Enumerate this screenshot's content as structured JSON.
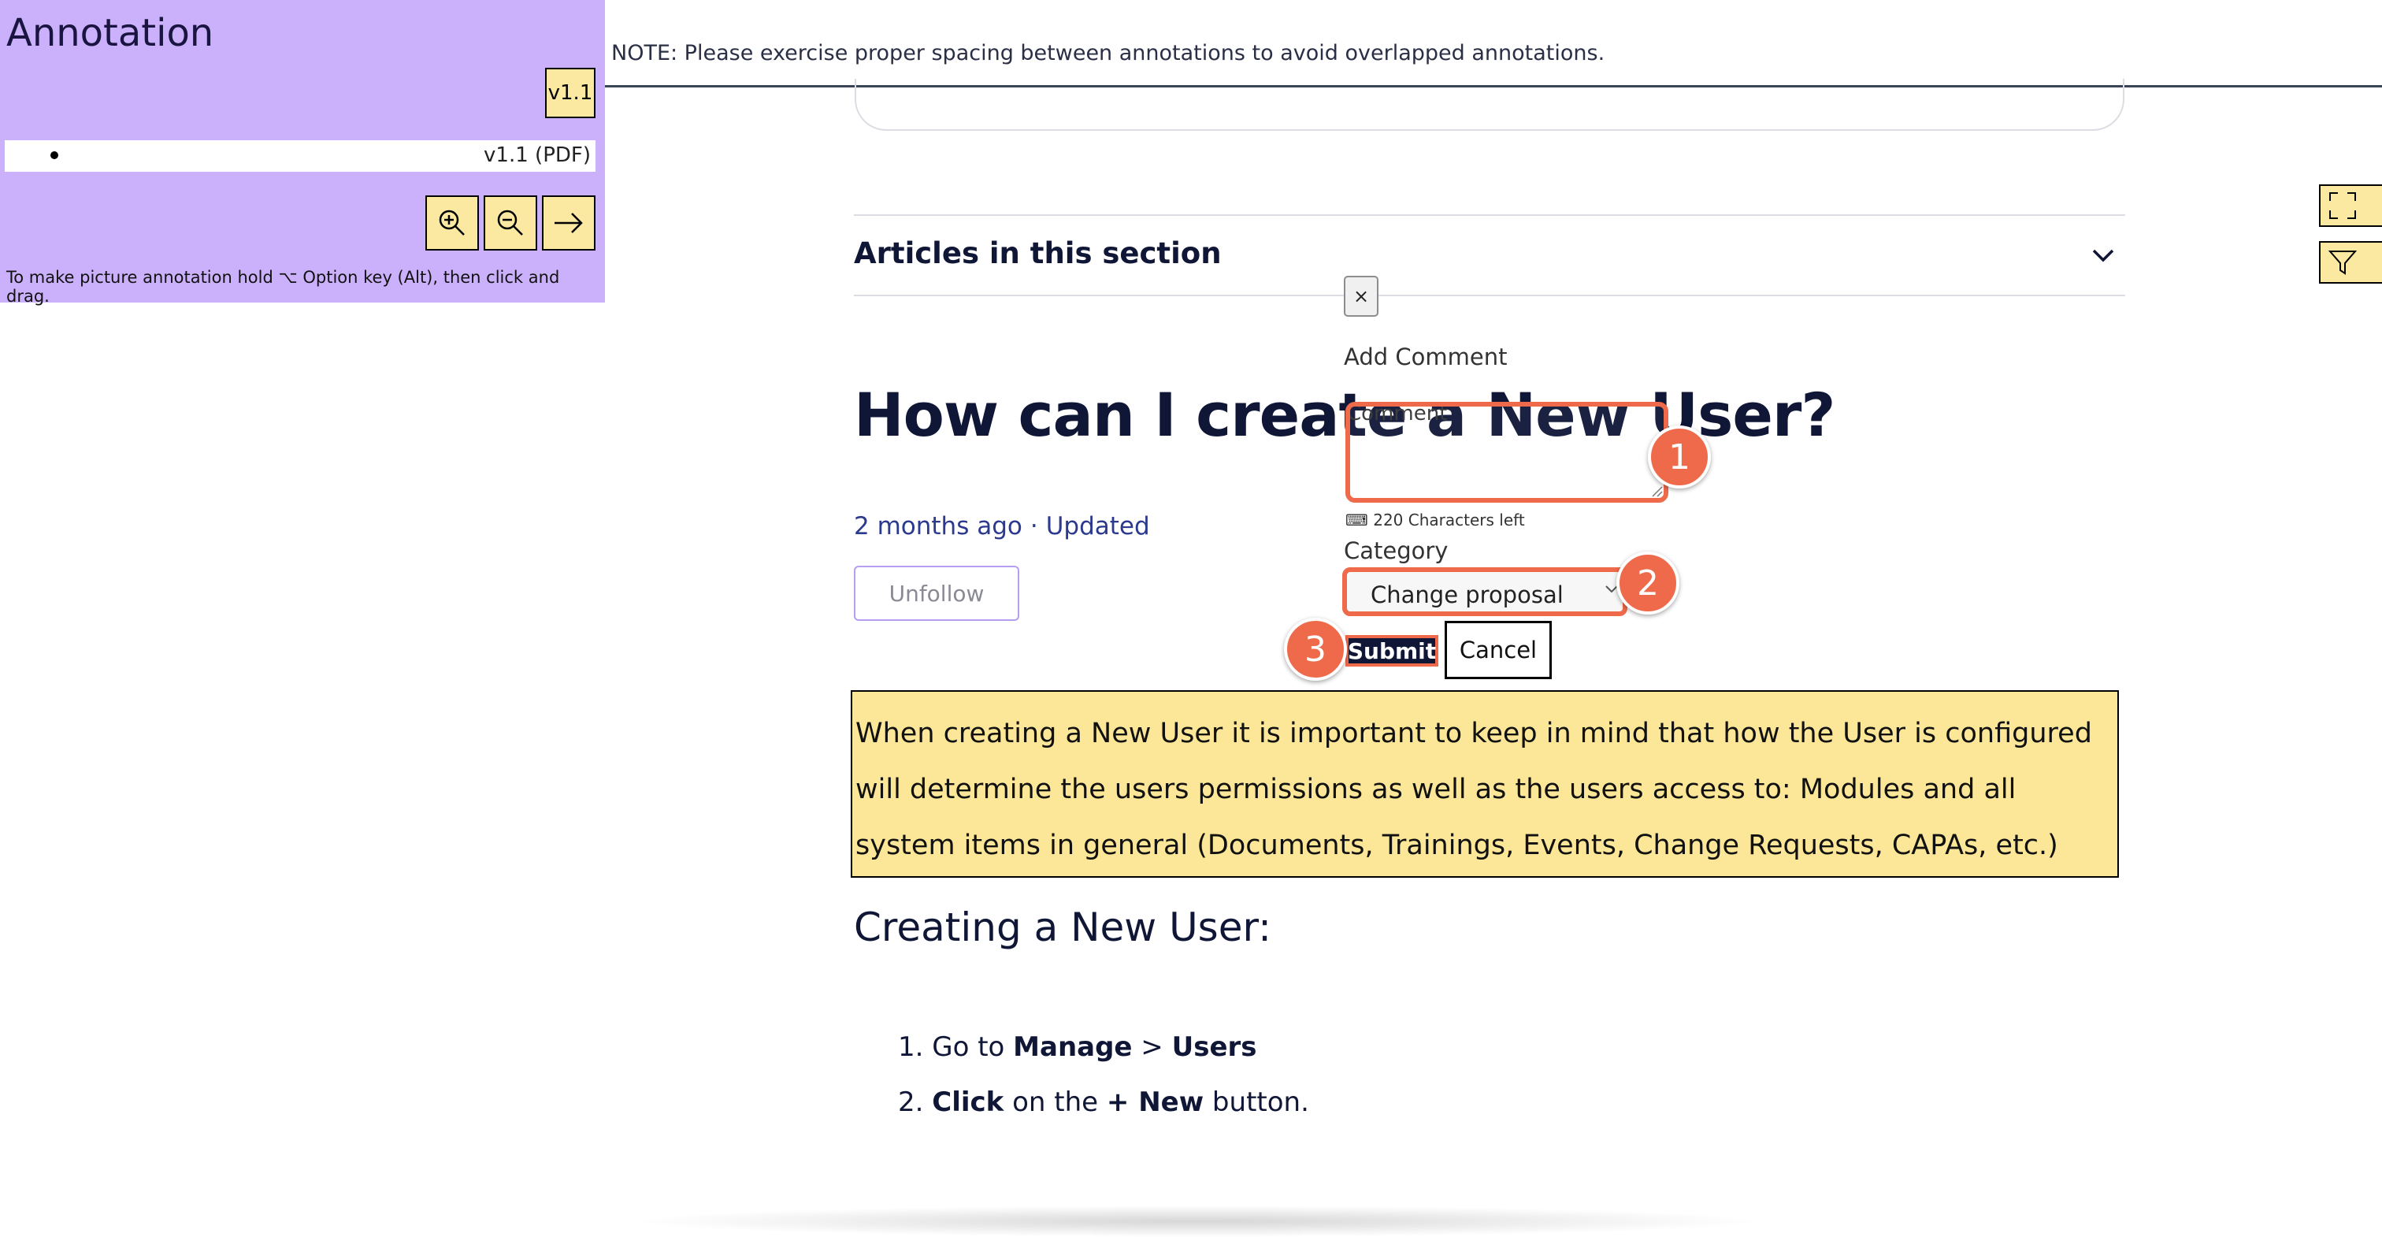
{
  "panel": {
    "title": "Annotation",
    "version_button": "v1.1",
    "version_items": [
      "v1.1 (PDF)"
    ],
    "hint": "To make picture annotation hold ⌥ Option key (Alt), then click and drag."
  },
  "note": "NOTE: Please exercise proper spacing between annotations to avoid overlapped annotations.",
  "article": {
    "section_title": "Articles in this section",
    "title": "How can I create a New User?",
    "meta_time": "2 months ago",
    "meta_separator": "·",
    "meta_updated": "Updated",
    "unfollow": "Unfollow",
    "highlight_text": "When creating a New User it is important to keep in mind that how the User is configured will determine the users permissions as well as the users access to: Modules and all system items in general (Documents, Trainings, Events, Change Requests, CAPAs, etc.)",
    "subheading": "Creating a New User:",
    "steps": [
      {
        "num": "1.",
        "pre": "Go to ",
        "b1": "Manage",
        "mid": " > ",
        "b2": "Users",
        "post": ""
      },
      {
        "num": "2.",
        "pre": "",
        "b1": "Click",
        "mid": " on the ",
        "b2": "+ New",
        "post": " button."
      }
    ]
  },
  "dialog": {
    "close": "×",
    "title": "Add Comment",
    "comment_label": "Comment",
    "chars_left": "⌨ 220 Characters left",
    "category_label": "Category",
    "category_value": "Change proposal",
    "submit": "Submit",
    "cancel": "Cancel"
  },
  "badges": [
    "1",
    "2",
    "3"
  ],
  "colors": {
    "panel_bg": "#cbb1fb",
    "button_yellow": "#fbe9a2",
    "highlight_bg": "#fce798",
    "accent_orange": "#ef6a4b",
    "navy": "#0f1636",
    "link_blue": "#2b3a8f"
  },
  "icons": [
    "zoom-in-icon",
    "zoom-out-icon",
    "arrow-right-icon",
    "chevron-down-icon",
    "expand-icon",
    "filter-icon"
  ]
}
